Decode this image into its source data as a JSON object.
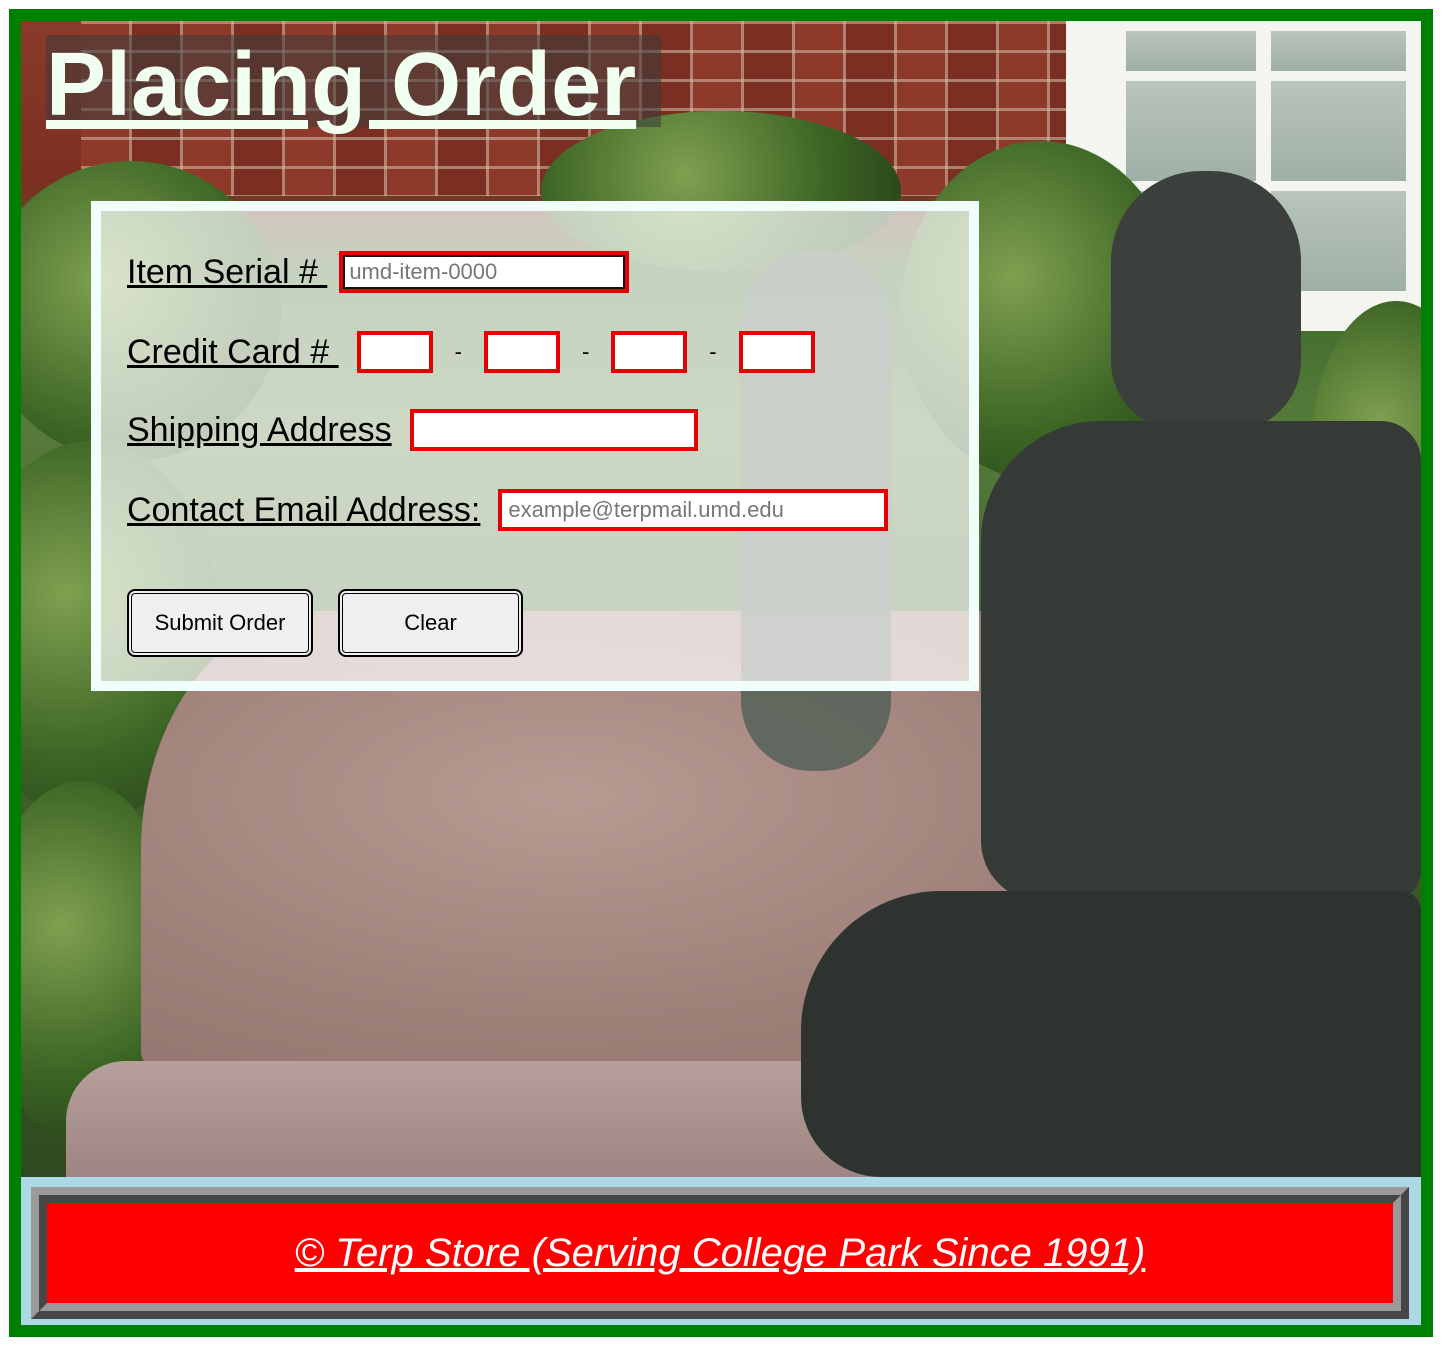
{
  "page": {
    "title": "Placing Order"
  },
  "form": {
    "serial_label": "Item Serial # ",
    "serial_placeholder": "umd-item-0000",
    "card_label": "Credit Card # ",
    "card_sep": "-",
    "shipping_label": "Shipping Address",
    "email_label": "Contact Email Address:",
    "email_placeholder": "example@terpmail.umd.edu",
    "submit_label": "Submit Order",
    "clear_label": "Clear"
  },
  "footer": {
    "text": "© Terp Store (Serving College Park Since 1991)"
  },
  "colors": {
    "frame": "#008000",
    "field_border": "#e60000",
    "footer_bg": "#ff0000",
    "footer_outer": "#add8e6"
  },
  "background": {
    "image": "statue-on-bench-photo"
  }
}
